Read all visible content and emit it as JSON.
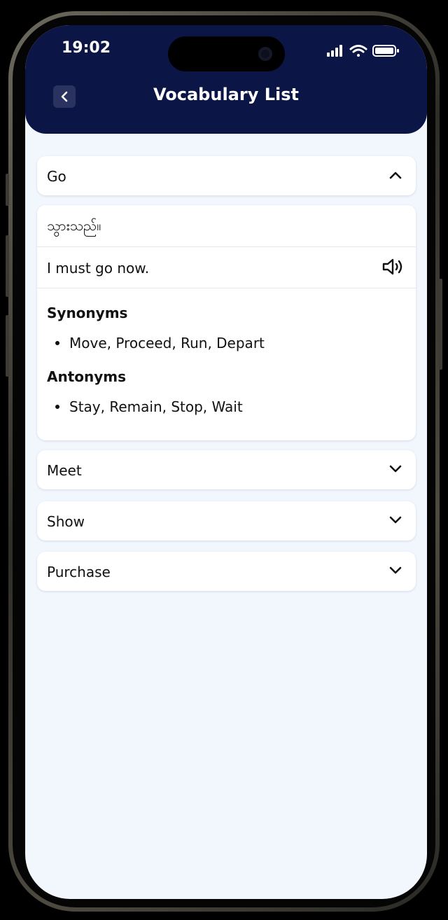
{
  "status_bar": {
    "time": "19:02",
    "icons": [
      "signal-icon",
      "wifi-icon",
      "battery-icon"
    ]
  },
  "header": {
    "title": "Vocabulary List",
    "back_icon": "chevron-left-icon"
  },
  "colors": {
    "header_bg": "#0b1646",
    "page_bg": "#f2f6fd",
    "card_bg": "#ffffff",
    "text": "#111111"
  },
  "vocab": {
    "expanded": {
      "word": "Go",
      "translation": "သွားသည်။",
      "example": "I must go now.",
      "synonyms_heading": "Synonyms",
      "synonyms": "Move, Proceed, Run, Depart",
      "antonyms_heading": "Antonyms",
      "antonyms": "Stay, Remain, Stop, Wait"
    },
    "collapsed": [
      "Meet",
      "Show",
      "Purchase"
    ]
  }
}
